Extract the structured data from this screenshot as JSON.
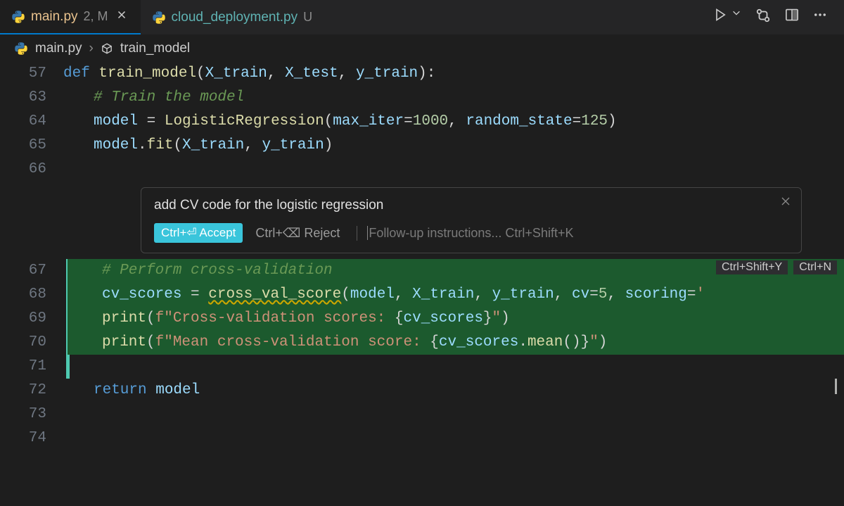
{
  "tabs": [
    {
      "filename": "main.py",
      "status": "2, M",
      "active": true,
      "has_close": true
    },
    {
      "filename": "cloud_deployment.py",
      "status": "U",
      "active": false,
      "has_close": false
    }
  ],
  "breadcrumb": {
    "file": "main.py",
    "symbol": "train_model"
  },
  "inline_chat": {
    "prompt": "add CV code for the logistic regression",
    "accept_label": "Ctrl+⏎ Accept",
    "reject_label": "Ctrl+⌫ Reject",
    "followup_placeholder": "Follow-up instructions... Ctrl+Shift+K"
  },
  "code_actions": {
    "action1": "Ctrl+Shift+Y",
    "action2": "Ctrl+N"
  },
  "code_lines": [
    {
      "num": "57",
      "tokens": [
        {
          "t": "def ",
          "c": "kw"
        },
        {
          "t": "train_model",
          "c": "fn"
        },
        {
          "t": "(",
          "c": "punct"
        },
        {
          "t": "X_train",
          "c": "param"
        },
        {
          "t": ", ",
          "c": "punct"
        },
        {
          "t": "X_test",
          "c": "param"
        },
        {
          "t": ", ",
          "c": "punct"
        },
        {
          "t": "y_train",
          "c": "param"
        },
        {
          "t": "):",
          "c": "punct"
        }
      ],
      "indent": 0
    },
    {
      "num": "63",
      "tokens": [
        {
          "t": "# Train the model",
          "c": "comment"
        }
      ],
      "indent": 1,
      "folded_before": true
    },
    {
      "num": "64",
      "tokens": [
        {
          "t": "model ",
          "c": "var"
        },
        {
          "t": "= ",
          "c": "op"
        },
        {
          "t": "LogisticRegression",
          "c": "fn"
        },
        {
          "t": "(",
          "c": "punct"
        },
        {
          "t": "max_iter",
          "c": "param"
        },
        {
          "t": "=",
          "c": "op"
        },
        {
          "t": "1000",
          "c": "num"
        },
        {
          "t": ", ",
          "c": "punct"
        },
        {
          "t": "random_state",
          "c": "param"
        },
        {
          "t": "=",
          "c": "op"
        },
        {
          "t": "125",
          "c": "num"
        },
        {
          "t": ")",
          "c": "punct"
        }
      ],
      "indent": 1
    },
    {
      "num": "65",
      "tokens": [
        {
          "t": "model",
          "c": "var"
        },
        {
          "t": ".",
          "c": "punct"
        },
        {
          "t": "fit",
          "c": "fn"
        },
        {
          "t": "(",
          "c": "punct"
        },
        {
          "t": "X_train",
          "c": "var"
        },
        {
          "t": ", ",
          "c": "punct"
        },
        {
          "t": "y_train",
          "c": "var"
        },
        {
          "t": ")",
          "c": "punct"
        }
      ],
      "indent": 1
    },
    {
      "num": "66",
      "tokens": [],
      "indent": 0
    }
  ],
  "inserted_lines": [
    {
      "num": "67",
      "tokens": [
        {
          "t": "# Perform cross-validation",
          "c": "comment"
        }
      ],
      "indent": 1
    },
    {
      "num": "68",
      "tokens": [
        {
          "t": "cv_scores ",
          "c": "var"
        },
        {
          "t": "= ",
          "c": "op"
        },
        {
          "t": "cross_val_score",
          "c": "fn",
          "squiggle": true
        },
        {
          "t": "(",
          "c": "punct"
        },
        {
          "t": "model",
          "c": "var"
        },
        {
          "t": ", ",
          "c": "punct"
        },
        {
          "t": "X_train",
          "c": "var"
        },
        {
          "t": ", ",
          "c": "punct"
        },
        {
          "t": "y_train",
          "c": "var"
        },
        {
          "t": ", ",
          "c": "punct"
        },
        {
          "t": "cv",
          "c": "param"
        },
        {
          "t": "=",
          "c": "op"
        },
        {
          "t": "5",
          "c": "num"
        },
        {
          "t": ", ",
          "c": "punct"
        },
        {
          "t": "scoring",
          "c": "param"
        },
        {
          "t": "=",
          "c": "op"
        },
        {
          "t": "'",
          "c": "str"
        }
      ],
      "indent": 1
    },
    {
      "num": "69",
      "tokens": [
        {
          "t": "print",
          "c": "fn"
        },
        {
          "t": "(",
          "c": "punct"
        },
        {
          "t": "f\"Cross-validation scores: ",
          "c": "str"
        },
        {
          "t": "{",
          "c": "punct"
        },
        {
          "t": "cv_scores",
          "c": "var"
        },
        {
          "t": "}",
          "c": "punct"
        },
        {
          "t": "\"",
          "c": "str"
        },
        {
          "t": ")",
          "c": "punct"
        }
      ],
      "indent": 1
    },
    {
      "num": "70",
      "tokens": [
        {
          "t": "print",
          "c": "fn"
        },
        {
          "t": "(",
          "c": "punct"
        },
        {
          "t": "f\"Mean cross-validation score: ",
          "c": "str"
        },
        {
          "t": "{",
          "c": "punct"
        },
        {
          "t": "cv_scores",
          "c": "var"
        },
        {
          "t": ".",
          "c": "punct"
        },
        {
          "t": "mean",
          "c": "fn"
        },
        {
          "t": "()",
          "c": "punct"
        },
        {
          "t": "}",
          "c": "punct"
        },
        {
          "t": "\"",
          "c": "str"
        },
        {
          "t": ")",
          "c": "punct"
        }
      ],
      "indent": 1
    },
    {
      "num": "71",
      "tokens": [],
      "indent": 0
    }
  ],
  "after_lines": [
    {
      "num": "72",
      "tokens": [
        {
          "t": "return ",
          "c": "kw"
        },
        {
          "t": "model",
          "c": "var"
        }
      ],
      "indent": 1,
      "cursor_end": true
    },
    {
      "num": "73",
      "tokens": [],
      "indent": 0
    },
    {
      "num": "74",
      "tokens": [],
      "indent": 0
    }
  ]
}
